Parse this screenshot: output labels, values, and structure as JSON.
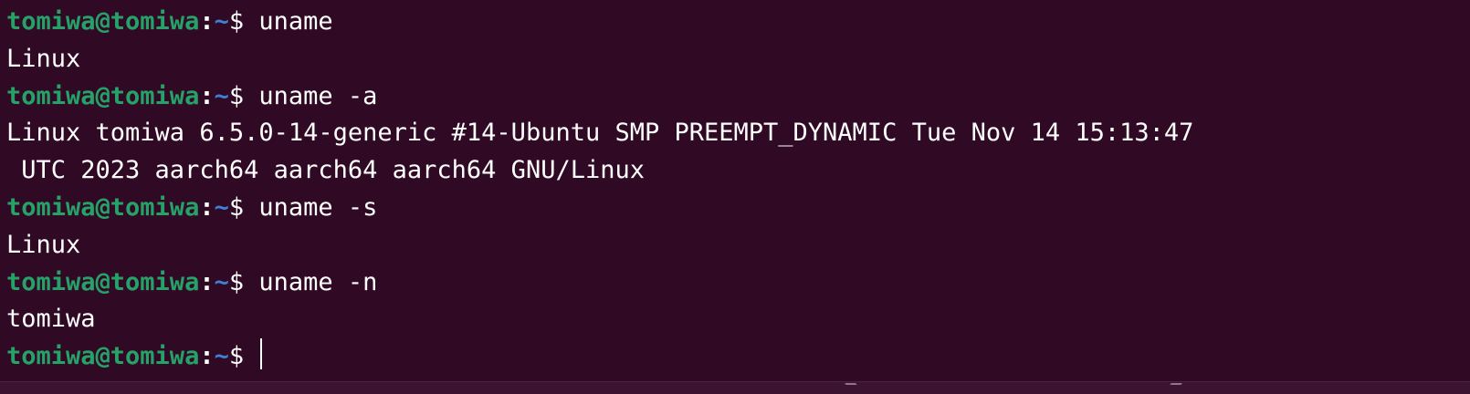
{
  "prompt": {
    "user_host": "tomiwa@tomiwa",
    "colon": ":",
    "path": "~",
    "dollar": "$ "
  },
  "lines": [
    {
      "type": "prompt",
      "command": "uname"
    },
    {
      "type": "output",
      "text": "Linux"
    },
    {
      "type": "prompt",
      "command": "uname -a"
    },
    {
      "type": "output",
      "text": "Linux tomiwa 6.5.0-14-generic #14-Ubuntu SMP PREEMPT_DYNAMIC Tue Nov 14 15:13:47"
    },
    {
      "type": "output",
      "text": " UTC 2023 aarch64 aarch64 aarch64 GNU/Linux"
    },
    {
      "type": "prompt",
      "command": "uname -s"
    },
    {
      "type": "output",
      "text": "Linux"
    },
    {
      "type": "prompt",
      "command": "uname -n"
    },
    {
      "type": "output",
      "text": "tomiwa"
    },
    {
      "type": "prompt",
      "command": ""
    }
  ],
  "colors": {
    "background": "#300a24",
    "user_host": "#26a269",
    "path": "#3f7fd6",
    "text": "#ffffff"
  }
}
